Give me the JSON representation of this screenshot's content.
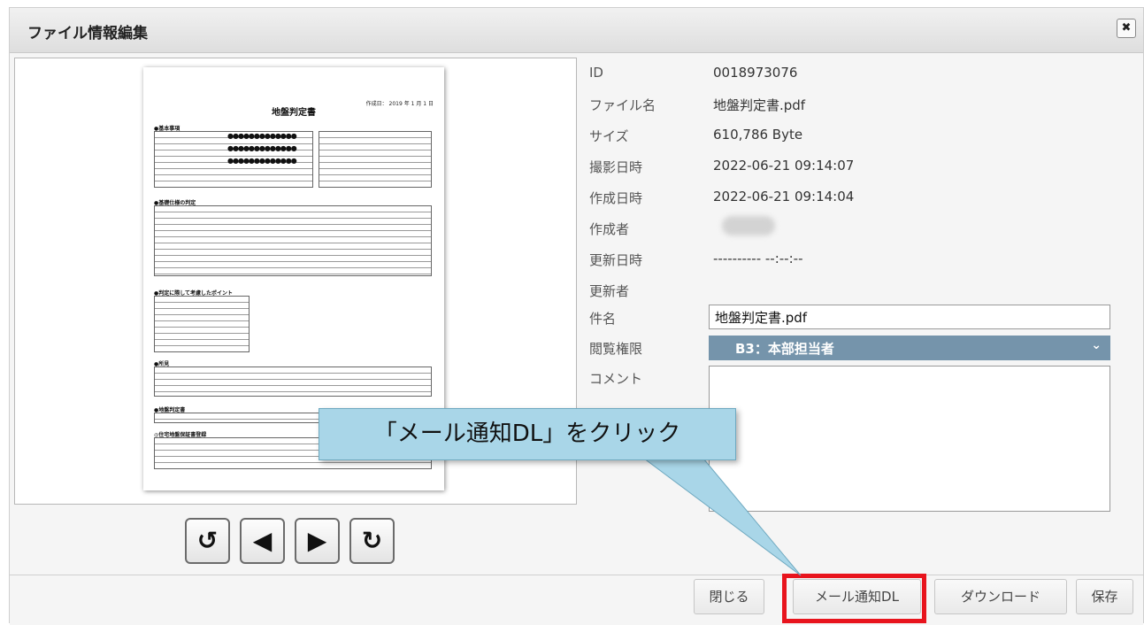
{
  "dialog": {
    "title": "ファイル情報編集",
    "close_label": "✖"
  },
  "document_preview": {
    "title": "地盤判定書",
    "date": "作成日： 2019 年 1 月 1 日",
    "sections": [
      "●基本事項",
      "●基礎仕様の判定",
      "●判定に際して考慮したポイント",
      "●所見",
      "●地盤判定書",
      "◎住宅地盤保証書登録"
    ],
    "masked": "●●●●●●●●●●●●●"
  },
  "nav": {
    "rotate_left": "↺",
    "prev": "◀",
    "next": "▶",
    "rotate_right": "↻"
  },
  "info": {
    "rows": [
      {
        "label": "ID",
        "value": "0018973076"
      },
      {
        "label": "ファイル名",
        "value": "地盤判定書.pdf"
      },
      {
        "label": "サイズ",
        "value": "610,786 Byte"
      },
      {
        "label": "撮影日時",
        "value": "2022-06-21 09:14:07"
      },
      {
        "label": "作成日時",
        "value": "2022-06-21 09:14:04"
      },
      {
        "label": "作成者",
        "value": ""
      },
      {
        "label": "更新日時",
        "value": "---------- --:--:--"
      },
      {
        "label": "更新者",
        "value": ""
      }
    ],
    "subject_label": "件名",
    "subject_value": "地盤判定書.pdf",
    "permission_label": "閲覧権限",
    "permission_value": "B3：本部担当者",
    "comment_label": "コメント",
    "comment_value": ""
  },
  "footer": {
    "close": "閉じる",
    "mail_dl": "メール通知DL",
    "download": "ダウンロード",
    "save": "保存"
  },
  "callout": {
    "text": "「メール通知DL」をクリック"
  },
  "colors": {
    "select_bg": "#7594ab",
    "callout_bg": "#a9d6e8",
    "highlight": "#e8141d"
  }
}
